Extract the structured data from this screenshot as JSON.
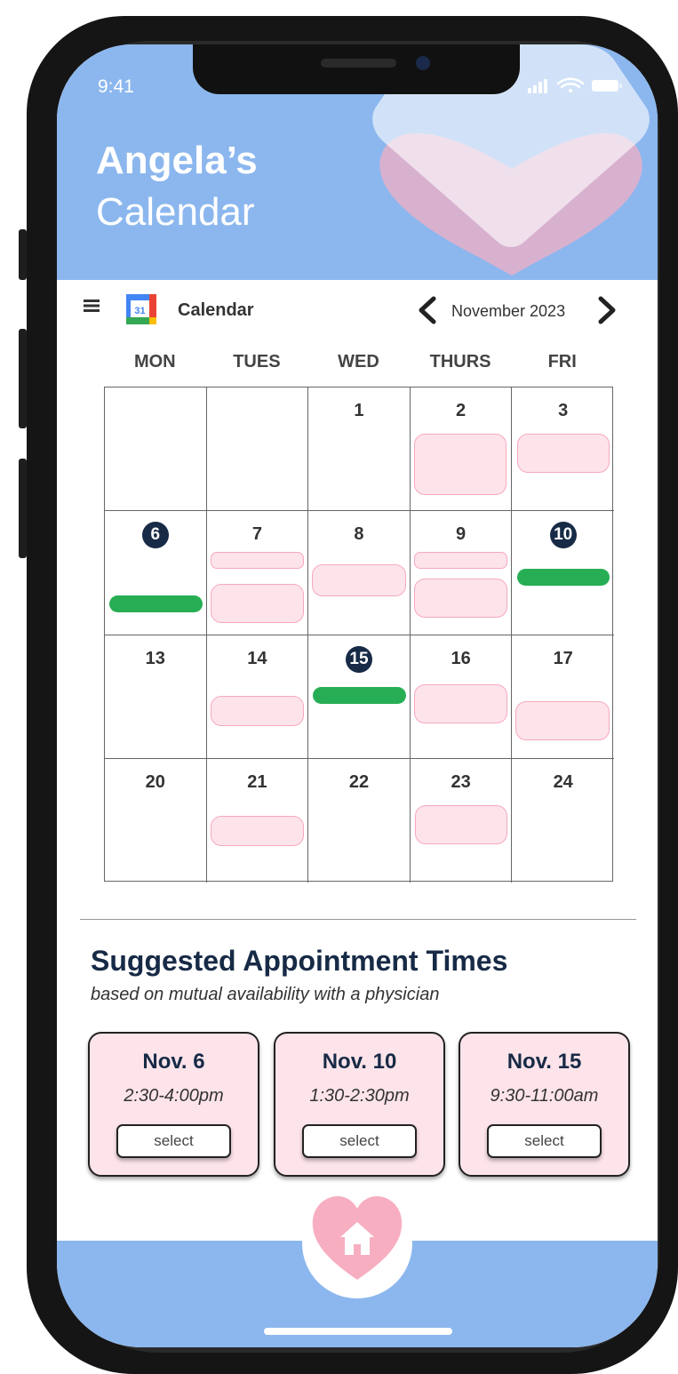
{
  "status_bar": {
    "time": "9:41"
  },
  "header": {
    "title_line1": "Angela’s",
    "title_line2": "Calendar"
  },
  "toolbar": {
    "app_name": "Calendar",
    "app_icon_number": "31",
    "month_label": "November 2023"
  },
  "weekdays": [
    "MON",
    "TUES",
    "WED",
    "THURS",
    "FRI"
  ],
  "calendar_weeks": [
    [
      {
        "day": ""
      },
      {
        "day": ""
      },
      {
        "day": "1"
      },
      {
        "day": "2"
      },
      {
        "day": "3"
      }
    ],
    [
      {
        "day": "6",
        "highlight": true
      },
      {
        "day": "7"
      },
      {
        "day": "8"
      },
      {
        "day": "9"
      },
      {
        "day": "10",
        "highlight": true
      }
    ],
    [
      {
        "day": "13"
      },
      {
        "day": "14"
      },
      {
        "day": "15",
        "highlight": true
      },
      {
        "day": "16"
      },
      {
        "day": "17"
      }
    ],
    [
      {
        "day": "20"
      },
      {
        "day": "21"
      },
      {
        "day": "22"
      },
      {
        "day": "23"
      },
      {
        "day": "24"
      }
    ]
  ],
  "suggestions": {
    "title": "Suggested Appointment Times",
    "subtitle": "based on mutual availability with a physician",
    "cards": [
      {
        "date": "Nov. 6",
        "time": "2:30-4:00pm",
        "button": "select"
      },
      {
        "date": "Nov. 10",
        "time": "1:30-2:30pm",
        "button": "select"
      },
      {
        "date": "Nov. 15",
        "time": "9:30-11:00am",
        "button": "select"
      }
    ]
  },
  "colors": {
    "header_blue": "#8cb7ee",
    "navy": "#172a46",
    "event_pink": "#fde4ea",
    "event_border": "#f6a9bd",
    "suggested_green": "#27ae55",
    "heart_pink": "#f7aec0"
  },
  "icons": {
    "menu": "hamburger-icon",
    "app": "google-calendar-icon",
    "prev": "chevron-left-icon",
    "next": "chevron-right-icon",
    "home": "home-icon"
  }
}
